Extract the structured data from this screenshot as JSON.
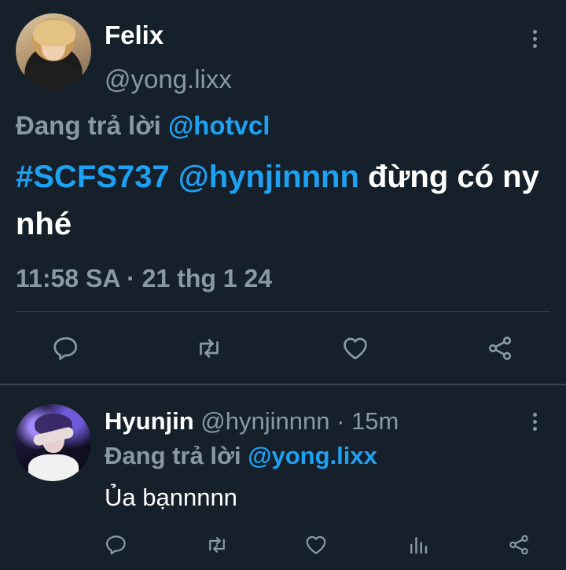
{
  "main_tweet": {
    "author_name": "Felix",
    "author_handle": "@yong.lixx",
    "replying_prefix": "Đang trả lời",
    "replying_to": "@hotvcl",
    "text_hashtag": "#SCFS737",
    "text_mention": "@hynjinnnn",
    "text_body": "đừng có ny nhé",
    "timestamp": "11:58 SA · 21 thg 1 24",
    "actions": [
      "reply-icon",
      "retweet-icon",
      "like-icon",
      "share-icon"
    ]
  },
  "reply_tweet": {
    "author_name": "Hyunjin",
    "author_meta": "@hynjinnnn · 15m",
    "replying_prefix": "Đang trả lời",
    "replying_to": "@yong.lixx",
    "text": "Ủa bạnnnnn",
    "actions": [
      "reply-icon",
      "retweet-icon",
      "like-icon",
      "stats-icon",
      "share-icon"
    ]
  },
  "colors": {
    "background": "#15202b",
    "text_primary": "#ffffff",
    "text_secondary": "#8899a6",
    "accent": "#1da1f2",
    "divider": "#38444d"
  }
}
